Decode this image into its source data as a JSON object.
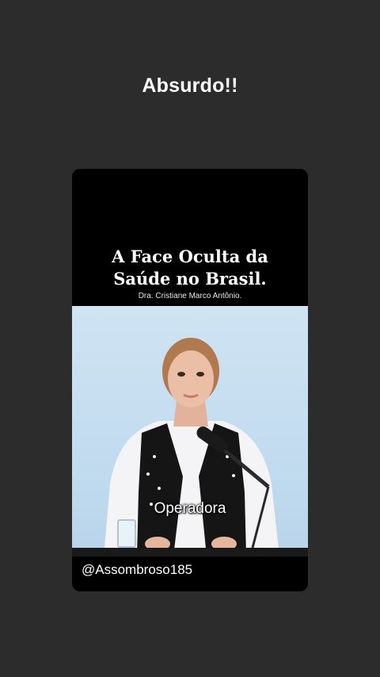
{
  "story": {
    "caption": "Absurdo!!"
  },
  "video": {
    "title_line1": "A Face Oculta da",
    "title_line2": "Saúde no Brasil.",
    "subtitle": "Dra. Cristiane Marco Antônio.",
    "overlay_caption": "Operadora",
    "watermark": "@Assombroso185"
  },
  "colors": {
    "page_background": "#2c2c2c",
    "card_background": "#000000",
    "studio_background": "#c8e0f1"
  }
}
